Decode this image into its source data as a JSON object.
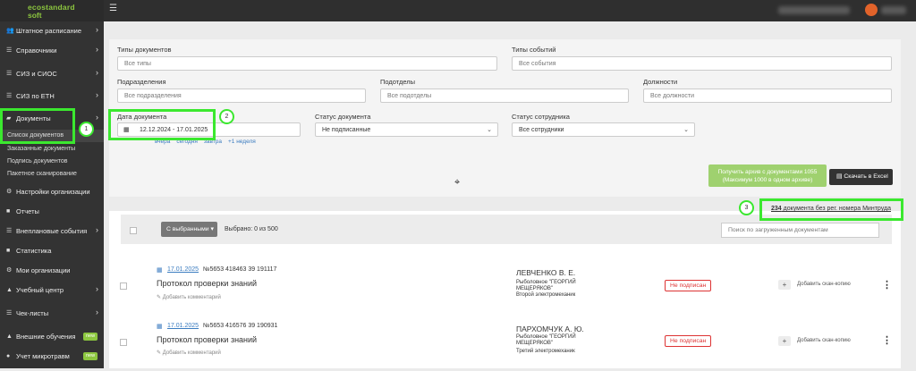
{
  "app": {
    "logo_line1": "ecostandard",
    "logo_line2": "soft"
  },
  "sidebar": {
    "items": [
      {
        "label": "Штатное расписание",
        "icon": "users-icon"
      },
      {
        "label": "Справочники",
        "icon": "list-icon"
      },
      {
        "label": "СИЗ и СИОС",
        "icon": "list-icon"
      },
      {
        "label": "СИЗ по ЕТН",
        "icon": "list-icon"
      },
      {
        "label": "Документы",
        "icon": "folder-open-icon"
      },
      {
        "label": "Настройки организации",
        "icon": "gear-icon"
      },
      {
        "label": "Отчеты",
        "icon": "square-icon"
      },
      {
        "label": "Внеплановые события",
        "icon": "list-icon"
      },
      {
        "label": "Статистика",
        "icon": "square-icon"
      },
      {
        "label": "Мои организации",
        "icon": "gear-icon"
      },
      {
        "label": "Учебный центр",
        "icon": "graduation-cap-icon"
      },
      {
        "label": "Чек-листы",
        "icon": "check-list-icon"
      },
      {
        "label": "Внешние обучения",
        "icon": "graduation-cap-icon",
        "badge": "new"
      },
      {
        "label": "Учет микротравм",
        "icon": "user-icon",
        "badge": "new"
      }
    ],
    "subitems": [
      "Список документов",
      "Заказанные документы",
      "Подпись документов",
      "Пакетное сканирование"
    ]
  },
  "filters": {
    "doc_types_label": "Типы документов",
    "doc_types_placeholder": "Все типы",
    "event_types_label": "Типы событий",
    "event_types_placeholder": "Все события",
    "divisions_label": "Подразделения",
    "divisions_placeholder": "Все подразделения",
    "subdivisions_label": "Подотделы",
    "subdivisions_placeholder": "Все подотделы",
    "positions_label": "Должности",
    "positions_placeholder": "Все должности",
    "doc_date_label": "Дата документа",
    "doc_date_value": "12.12.2024 - 17.01.2025",
    "quick_dates": [
      "вчера",
      "сегодня",
      "завтра",
      "+1 неделя"
    ],
    "doc_status_label": "Статус документа",
    "doc_status_value": "Не подписанные",
    "employee_status_label": "Статус сотрудника",
    "employee_status_value": "Все сотрудники"
  },
  "actions": {
    "archive_line1": "Получить архив с документами 1055",
    "archive_line2": "(Максимум 1000 в одном архиве)",
    "excel_label": "Скачать в Excel"
  },
  "summary": {
    "count": "234",
    "text": " документа без рег. номера Минтруда"
  },
  "list": {
    "selected_button": "С выбранными",
    "selected_count": "Выбрано: 0 из 500",
    "search_placeholder": "Поиск по загруженным документам"
  },
  "rows": [
    {
      "date": "17.01.2025",
      "number": "№5653 418463 39 191117",
      "title": "Протокол проверки знаний",
      "comment": "Добавить комментарий",
      "person": "ЛЕВЧЕНКО В. Е.",
      "org": "Рыболовное \"ГЕОРГИЙ МЕЩЕРЯКОВ\"",
      "position": "Второй электромеханик",
      "status": "Не подписан",
      "add_scan": "Добавить скан-копию"
    },
    {
      "date": "17.01.2025",
      "number": "№5653 416576 39 190931",
      "title": "Протокол проверки знаний",
      "comment": "Добавить комментарий",
      "person": "ПАРХОМЧУК А. Ю.",
      "org": "Рыболовное \"ГЕОРГИЙ МЕЩЕРЯКОВ\"",
      "position": "Третий электромеханик",
      "status": "Не подписан",
      "add_scan": "Добавить скан-копию"
    }
  ],
  "annotations": [
    "1",
    "2",
    "3"
  ],
  "colors": {
    "accent": "#8cc63f",
    "annotation": "#3be82f",
    "status_red": "#dd3333",
    "link": "#3b7cc0"
  }
}
